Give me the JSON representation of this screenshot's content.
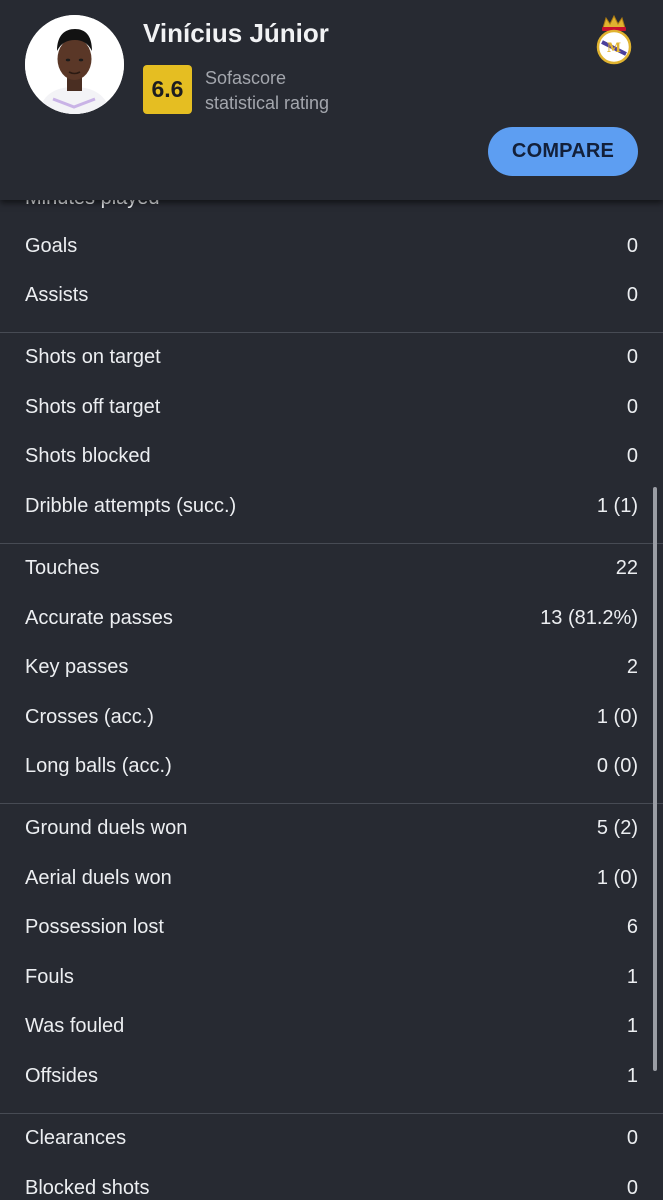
{
  "player": {
    "name": "Vinícius Júnior",
    "rating": "6.6",
    "rating_label_line1": "Sofascore",
    "rating_label_line2": "statistical rating",
    "crest_icon": "real-madrid-crest-icon"
  },
  "actions": {
    "compare_label": "COMPARE"
  },
  "colors": {
    "background": "#272a32",
    "rating_badge": "#e5be22",
    "compare_button": "#5d9ef2",
    "divider": "#474b54"
  },
  "stats": {
    "partial_top_label": "Minutes played",
    "groups": [
      [
        {
          "label": "Goals",
          "value": "0"
        },
        {
          "label": "Assists",
          "value": "0"
        }
      ],
      [
        {
          "label": "Shots on target",
          "value": "0"
        },
        {
          "label": "Shots off target",
          "value": "0"
        },
        {
          "label": "Shots blocked",
          "value": "0"
        },
        {
          "label": "Dribble attempts (succ.)",
          "value": "1 (1)"
        }
      ],
      [
        {
          "label": "Touches",
          "value": "22"
        },
        {
          "label": "Accurate passes",
          "value": "13 (81.2%)"
        },
        {
          "label": "Key passes",
          "value": "2"
        },
        {
          "label": "Crosses (acc.)",
          "value": "1 (0)"
        },
        {
          "label": "Long balls (acc.)",
          "value": "0 (0)"
        }
      ],
      [
        {
          "label": "Ground duels won",
          "value": "5 (2)"
        },
        {
          "label": "Aerial duels won",
          "value": "1 (0)"
        },
        {
          "label": "Possession lost",
          "value": "6"
        },
        {
          "label": "Fouls",
          "value": "1"
        },
        {
          "label": "Was fouled",
          "value": "1"
        },
        {
          "label": "Offsides",
          "value": "1"
        }
      ],
      [
        {
          "label": "Clearances",
          "value": "0"
        },
        {
          "label": "Blocked shots",
          "value": "0"
        }
      ]
    ]
  }
}
